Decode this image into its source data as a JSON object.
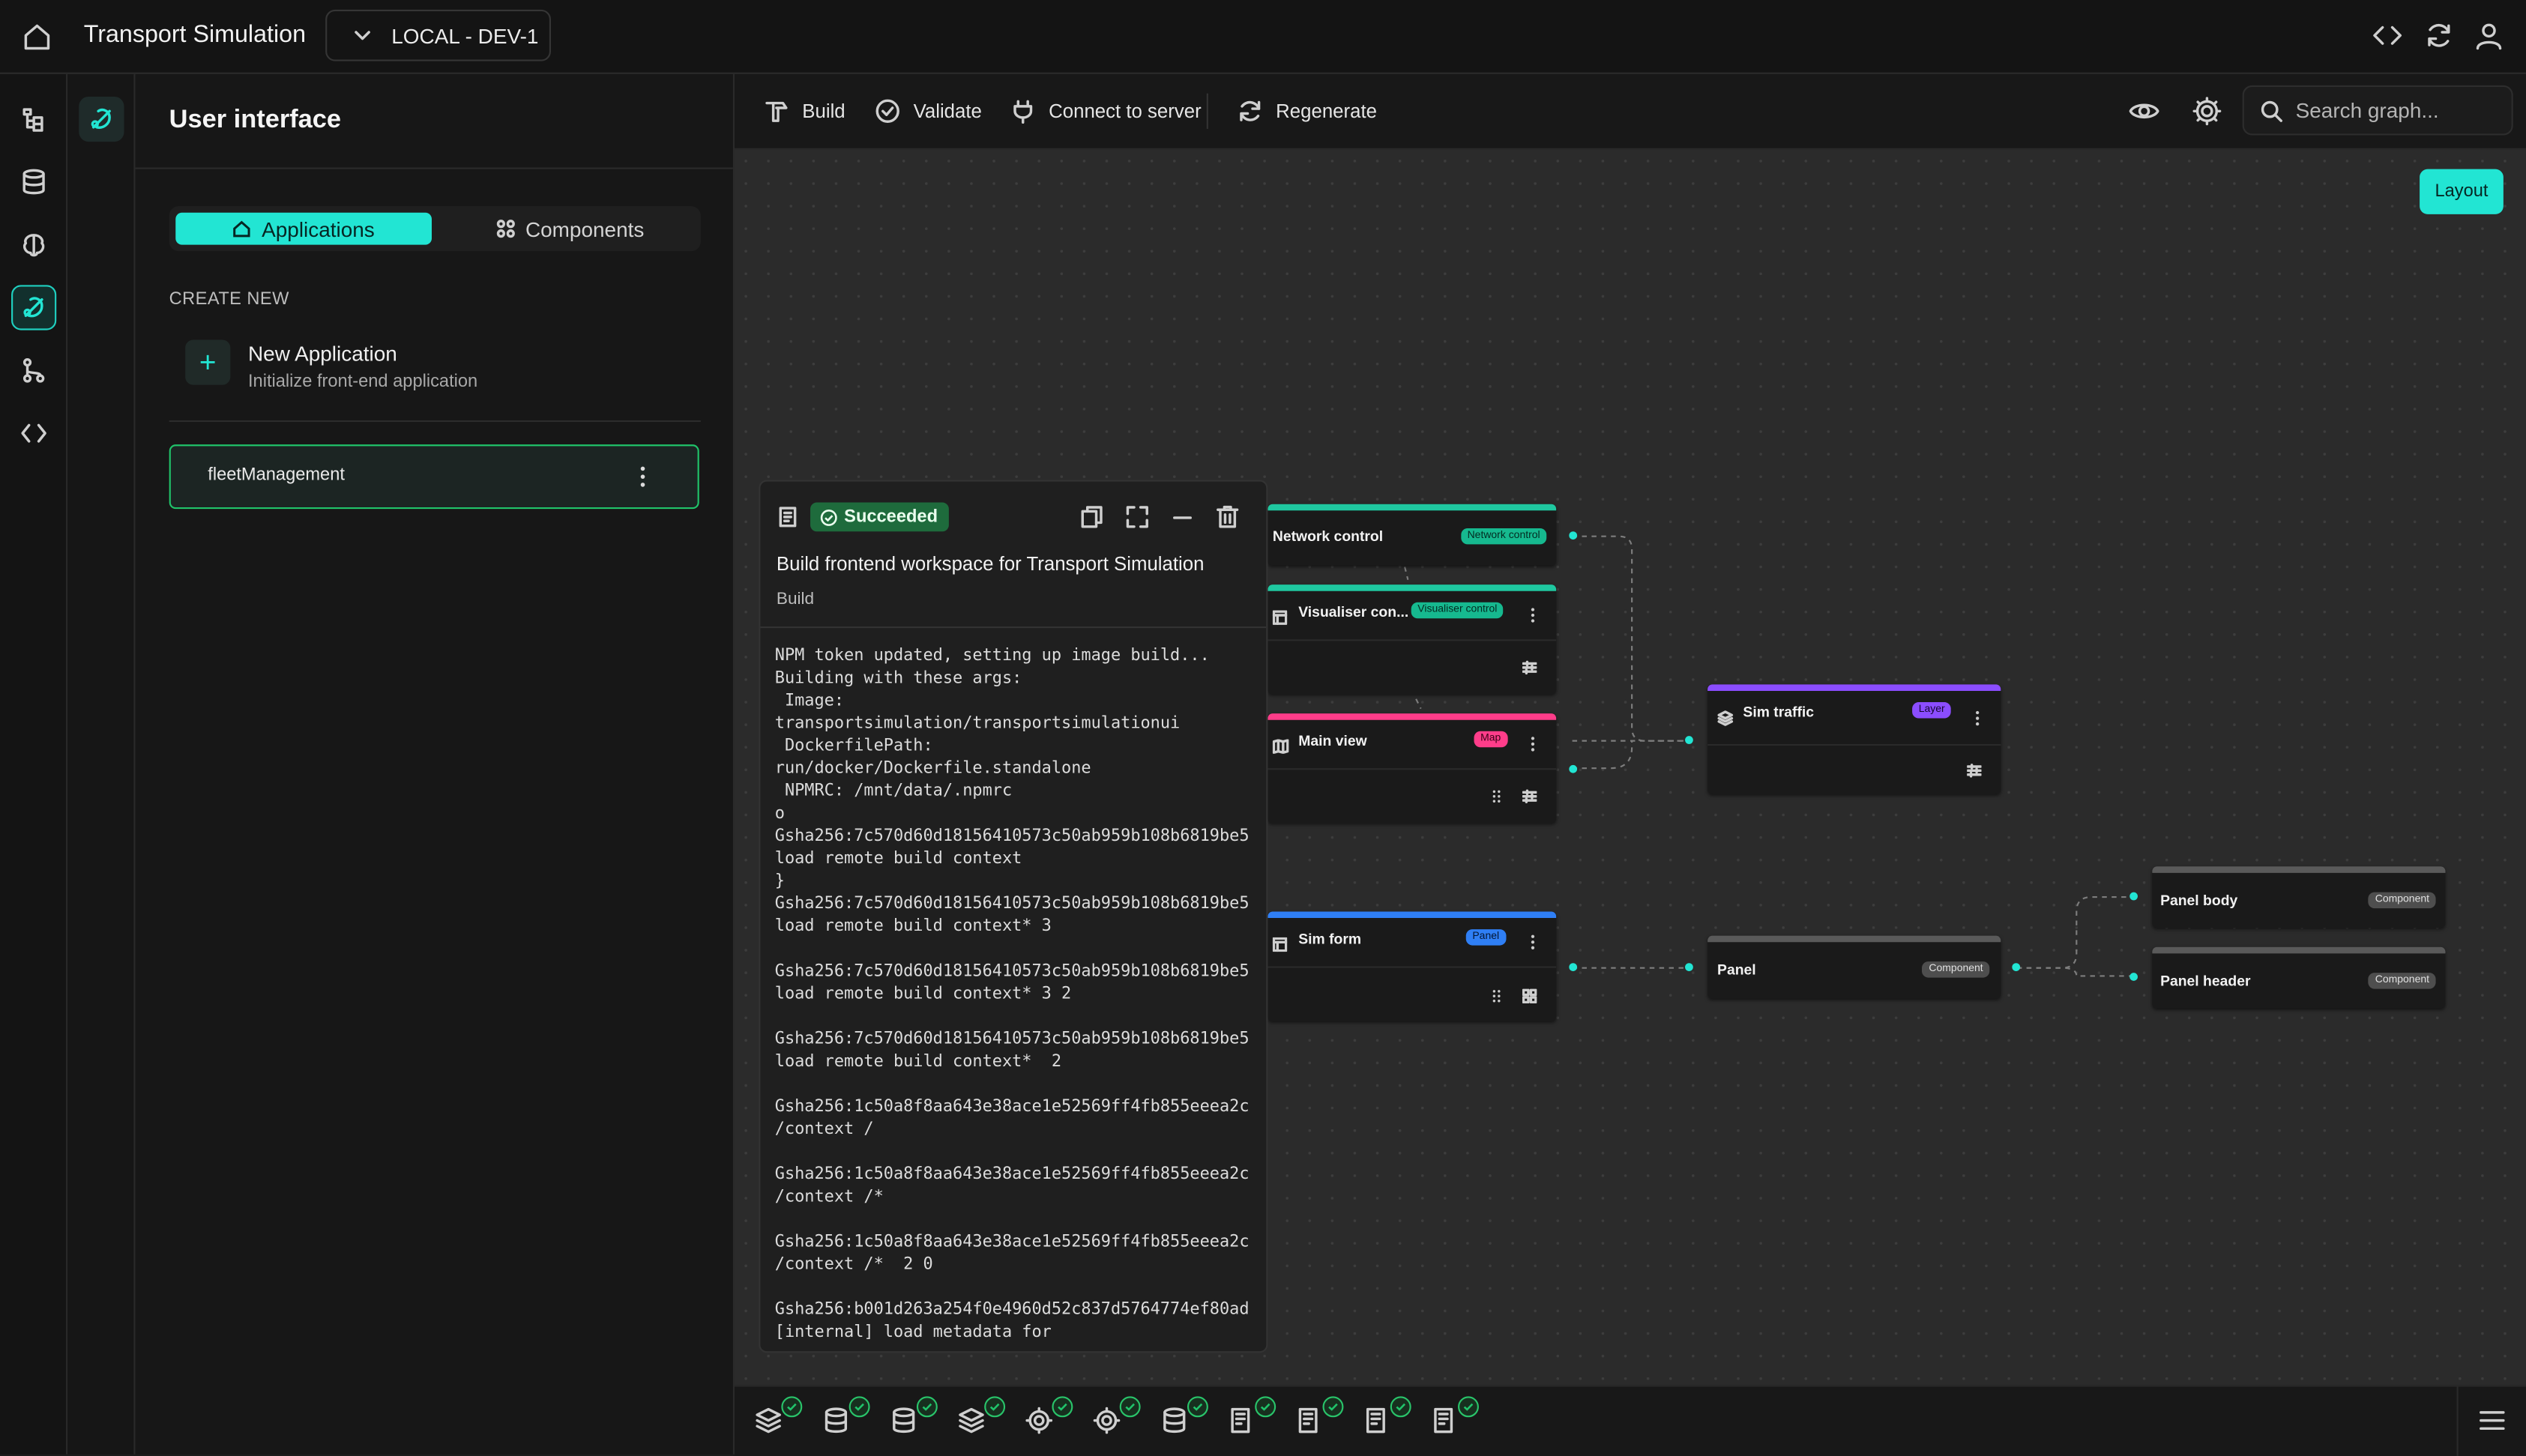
{
  "header": {
    "app_title": "Transport Simulation",
    "environment": "LOCAL - DEV-1"
  },
  "panel": {
    "title": "User interface",
    "tabs": [
      {
        "label": "Applications",
        "active": true
      },
      {
        "label": "Components",
        "active": false
      }
    ],
    "create_new_label": "CREATE NEW",
    "new_application": {
      "title": "New Application",
      "subtitle": "Initialize front-end application"
    },
    "applications": [
      {
        "name": "fleetManagement",
        "selected": true
      }
    ]
  },
  "toolbar": {
    "build_label": "Build",
    "validate_label": "Validate",
    "connect_label": "Connect to server",
    "regenerate_label": "Regenerate",
    "search_placeholder": "Search graph..."
  },
  "canvas": {
    "layout_button": "Layout",
    "nodes": {
      "network_control": {
        "label": "Network control",
        "badge": "Network control"
      },
      "visualiser_control": {
        "label": "Visualiser con...",
        "badge": "Visualiser control"
      },
      "main_view": {
        "label": "Main view",
        "badge": "Map"
      },
      "sim_form": {
        "label": "Sim form",
        "badge": "Panel"
      },
      "sim_traffic": {
        "label": "Sim traffic",
        "badge": "Layer"
      },
      "panel": {
        "label": "Panel",
        "badge": "Component"
      },
      "panel_body": {
        "label": "Panel body",
        "badge": "Component"
      },
      "panel_header": {
        "label": "Panel header",
        "badge": "Component"
      }
    }
  },
  "build_log": {
    "status": "Succeeded",
    "title": "Build frontend workspace for Transport Simulation",
    "subtitle": "Build",
    "lines": "NPM token updated, setting up image build...\nBuilding with these args:\n Image:\ntransportsimulation/transportsimulationui\n DockerfilePath:\nrun/docker/Dockerfile.standalone\n NPMRC: /mnt/data/.npmrc\no\nGsha256:7c570d60d18156410573c50ab959b108b6819be5\nload remote build context\n}\nGsha256:7c570d60d18156410573c50ab959b108b6819be5\nload remote build context* 3\n\nGsha256:7c570d60d18156410573c50ab959b108b6819be5\nload remote build context* 3 2\n\nGsha256:7c570d60d18156410573c50ab959b108b6819be5\nload remote build context*  2\n\nGsha256:1c50a8f8aa643e38ace1e52569ff4fb855eeea2c\n/context /\n\nGsha256:1c50a8f8aa643e38ace1e52569ff4fb855eeea2c\n/context /*\n\nGsha256:1c50a8f8aa643e38ace1e52569ff4fb855eeea2c\n/context /*  2 0\n\nGsha256:b001d263a254f0e4960d52c837d5764774ef80ad\n[internal] load metadata for"
  },
  "bottom_tasks": [
    {
      "icon": "layers-icon",
      "status": "success"
    },
    {
      "icon": "database-icon",
      "status": "success"
    },
    {
      "icon": "database-icon",
      "status": "success"
    },
    {
      "icon": "layers-icon",
      "status": "success"
    },
    {
      "icon": "gear-icon",
      "status": "success"
    },
    {
      "icon": "gear-icon",
      "status": "success"
    },
    {
      "icon": "database-icon",
      "status": "success"
    },
    {
      "icon": "document-icon",
      "status": "success"
    },
    {
      "icon": "document-icon",
      "status": "success"
    },
    {
      "icon": "document-icon",
      "status": "success"
    },
    {
      "icon": "document-icon",
      "status": "success"
    }
  ],
  "colors": {
    "accent": "#22e5d3",
    "success": "#20c36a",
    "network_control_bar": "#1fc8a0",
    "visualiser_control_bar": "#1fc8a0",
    "main_view_bar": "#ff3d8a",
    "sim_form_bar": "#2f7ff5",
    "sim_traffic_bar": "#8b4dff",
    "component_bar": "#5a5a5a"
  }
}
